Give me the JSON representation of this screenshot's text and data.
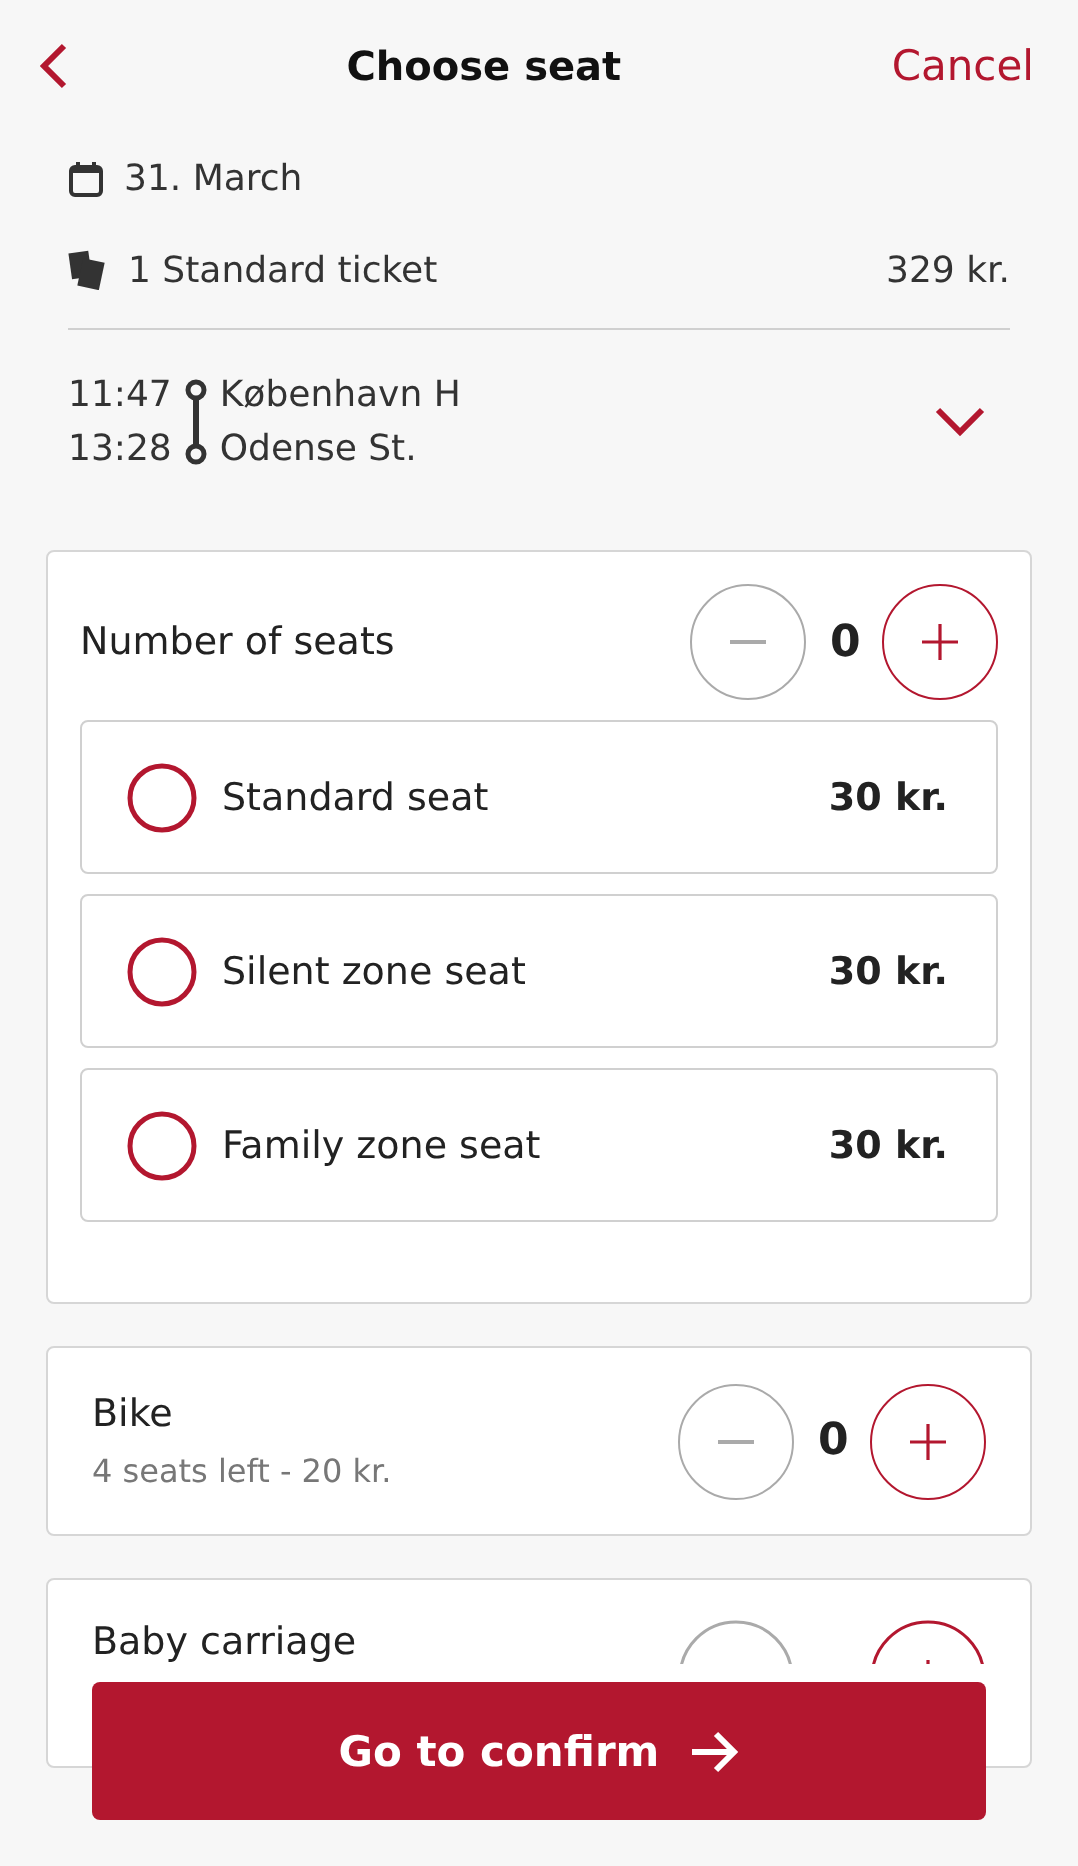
{
  "header": {
    "title": "Choose seat",
    "cancel": "Cancel"
  },
  "summary": {
    "date": "31. March",
    "ticket": "1 Standard ticket",
    "price": "329 kr."
  },
  "trip": {
    "departure_time": "11:47",
    "arrival_time": "13:28",
    "from": "København H",
    "to": "Odense St.",
    "expanded": false
  },
  "seats": {
    "label": "Number of seats",
    "count": "0",
    "decrement_disabled": true,
    "options": [
      {
        "label": "Standard seat",
        "price": "30 kr.",
        "selected": false
      },
      {
        "label": "Silent zone seat",
        "price": "30 kr.",
        "selected": false
      },
      {
        "label": "Family zone seat",
        "price": "30 kr.",
        "selected": false
      }
    ]
  },
  "extras": [
    {
      "label": "Bike",
      "detail": "4 seats left - 20 kr.",
      "count": "0",
      "decrement_disabled": true
    },
    {
      "label": "Baby carriage",
      "decrement_disabled": true
    }
  ],
  "confirm_button": "Go to confirm"
}
